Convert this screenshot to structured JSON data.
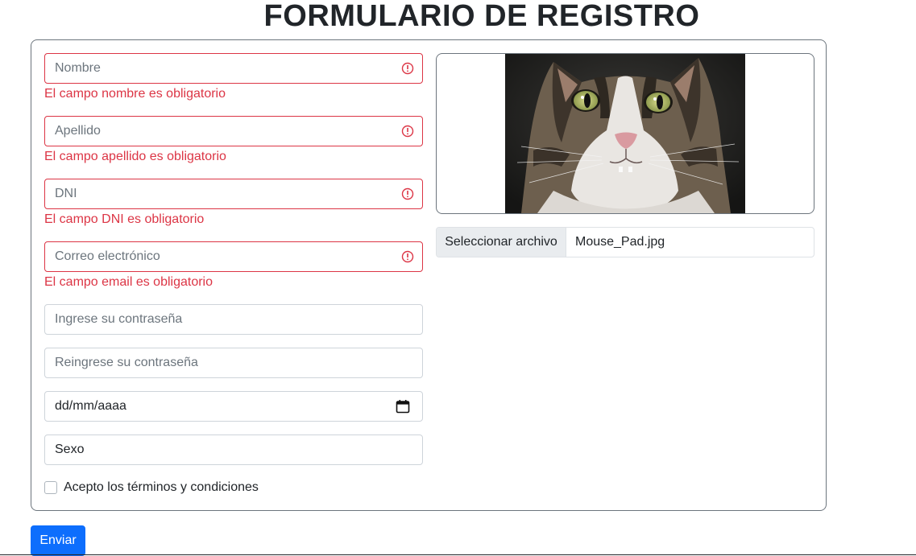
{
  "form": {
    "title": "FORMULARIO DE REGISTRO",
    "fields": {
      "nombre": {
        "placeholder": "Nombre",
        "error": "El campo nombre es obligatorio"
      },
      "apellido": {
        "placeholder": "Apellido",
        "error": "El campo apellido es obligatorio"
      },
      "dni": {
        "placeholder": "DNI",
        "error": "El campo DNI es obligatorio"
      },
      "email": {
        "placeholder": "Correo electrónico",
        "error": "El campo email es obligatorio"
      },
      "password": {
        "placeholder": "Ingrese su contraseña"
      },
      "password_repeat": {
        "placeholder": "Reingrese su contraseña"
      },
      "birthdate": {
        "value": "dd/mm/aaaa"
      },
      "sexo": {
        "value": "Sexo"
      }
    },
    "terms_label": "Acepto los términos y condiciones",
    "file": {
      "button_label": "Seleccionar archivo",
      "filename": "Mouse_Pad.jpg"
    },
    "submit_label": "Enviar"
  },
  "colors": {
    "error": "#dc3545",
    "primary": "#0d6efd",
    "border": "#ced4da"
  },
  "icons": {
    "error": "exclamation-circle-icon",
    "calendar": "calendar-icon"
  }
}
